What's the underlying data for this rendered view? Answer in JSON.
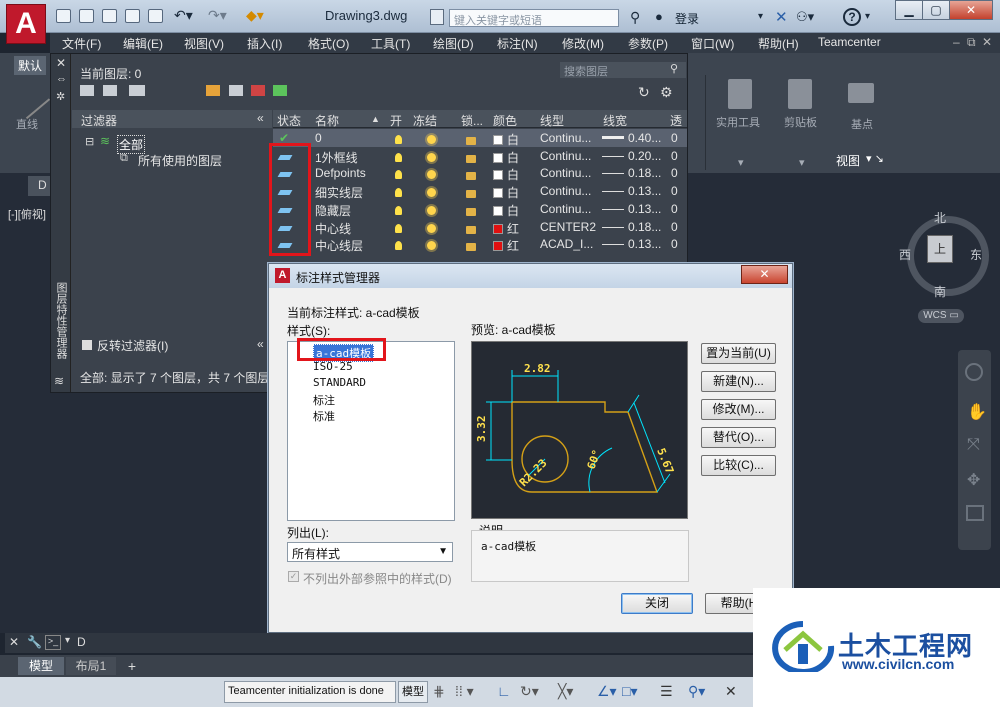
{
  "titlebar": {
    "doc_title": "Drawing3.dwg",
    "search_placeholder": "键入关键字或短语",
    "login": "登录",
    "app_logo": "A"
  },
  "menu": [
    "文件(F)",
    "编辑(E)",
    "视图(V)",
    "插入(I)",
    "格式(O)",
    "工具(T)",
    "绘图(D)",
    "标注(N)",
    "修改(M)",
    "参数(P)",
    "窗口(W)",
    "帮助(H)",
    "Teamcenter"
  ],
  "ribbon": {
    "tab_default": "默认",
    "left_tool": "直线",
    "groups": [
      "实用工具",
      "剪贴板",
      "基点",
      "视图"
    ],
    "doc_tab": "D",
    "view_label": "[-][俯视]"
  },
  "layer_panel": {
    "current_layer": "当前图层: 0",
    "search_placeholder": "搜索图层",
    "side_title": "图层特性管理器",
    "filters_header": "过滤器",
    "filter_all": "全部",
    "filter_used": "所有使用的图层",
    "invert_filter": "反转过滤器(I)",
    "summary": "全部: 显示了 7 个图层，共 7 个图层",
    "columns": [
      "状态",
      "名称",
      "开",
      "冻结",
      "锁...",
      "颜色",
      "线型",
      "线宽",
      "透"
    ],
    "layers": [
      {
        "name": "0",
        "color_name": "白",
        "color": "#ffffff",
        "linetype": "Continu...",
        "lineweight": "0.40...",
        "transparency": "0",
        "status": "current"
      },
      {
        "name": "1外框线",
        "color_name": "白",
        "color": "#ffffff",
        "linetype": "Continu...",
        "lineweight": "0.20...",
        "transparency": "0",
        "status": "layer"
      },
      {
        "name": "Defpoints",
        "color_name": "白",
        "color": "#ffffff",
        "linetype": "Continu...",
        "lineweight": "0.18...",
        "transparency": "0",
        "status": "layer"
      },
      {
        "name": "细实线层",
        "color_name": "白",
        "color": "#ffffff",
        "linetype": "Continu...",
        "lineweight": "0.13...",
        "transparency": "0",
        "status": "layer"
      },
      {
        "name": "隐藏层",
        "color_name": "白",
        "color": "#ffffff",
        "linetype": "Continu...",
        "lineweight": "0.13...",
        "transparency": "0",
        "status": "layer"
      },
      {
        "name": "中心线",
        "color_name": "红",
        "color": "#e01010",
        "linetype": "CENTER2",
        "lineweight": "0.18...",
        "transparency": "0",
        "status": "layer"
      },
      {
        "name": "中心线层",
        "color_name": "红",
        "color": "#e01010",
        "linetype": "ACAD_I...",
        "lineweight": "0.13...",
        "transparency": "0",
        "status": "layer"
      }
    ]
  },
  "dialog": {
    "title": "标注样式管理器",
    "current_style": "当前标注样式: a-cad模板",
    "styles_label": "样式(S):",
    "styles": [
      "a-cad模板",
      "ISO-25",
      "STANDARD",
      "标注",
      "标准"
    ],
    "preview_label": "预览: a-cad模板",
    "buttons": [
      "置为当前(U)",
      "新建(N)...",
      "修改(M)...",
      "替代(O)...",
      "比较(C)..."
    ],
    "list_label": "列出(L):",
    "list_value": "所有样式",
    "exclude_xref": "不列出外部参照中的样式(D)",
    "desc_label": "说明",
    "desc_value": "a-cad模板",
    "close": "关闭",
    "help": "帮助(H)",
    "preview_dims": {
      "top": "2.82",
      "left": "3.32",
      "slant": "5.67",
      "radius": "R2.23",
      "angle": "60°"
    }
  },
  "navcube": {
    "north": "北",
    "south": "南",
    "east": "东",
    "west": "西",
    "top": "上",
    "wcs": "WCS"
  },
  "cmdline": {
    "text": "D"
  },
  "layout_tabs": [
    "模型",
    "布局1"
  ],
  "statusbar": {
    "message": "Teamcenter initialization is done",
    "model": "模型"
  },
  "watermark": {
    "title": "土木工程网",
    "url": "www.civilcn.com"
  }
}
